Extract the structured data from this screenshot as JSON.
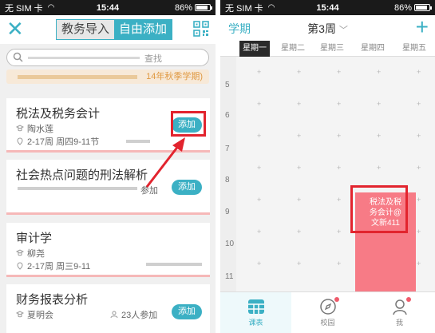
{
  "status_left": {
    "carrier": "无 SIM 卡",
    "wifi_icon": "wifi-icon",
    "time": "15:44",
    "battery": "86%",
    "battery_level": 0.86
  },
  "status_right": {
    "carrier": "无 SIM 卡",
    "wifi_icon": "wifi-icon",
    "time": "15:44",
    "battery": "86%",
    "battery_level": 0.86
  },
  "left_screen": {
    "close_icon": "close-icon",
    "tabs": [
      "教务导入",
      "自由添加"
    ],
    "active_tab": "自由添加",
    "qr_icon": "qr-code-icon",
    "search_placeholder": "查找",
    "semester_label": "14年秋季学期)",
    "accent_color": "#3bb0c4",
    "courses": [
      {
        "title": "税法及税务会计",
        "teacher": "陶水莲",
        "time": "2-17周 周四9-11节",
        "button": "添加"
      },
      {
        "title": "社会热点问题的刑法解析",
        "participants": "参加",
        "button": "添加"
      },
      {
        "title": "审计学",
        "teacher": "柳尧",
        "time": "2-17周 周三9-11"
      },
      {
        "title": "财务报表分析",
        "teacher": "夏明会",
        "participants": "23人参加",
        "button": "添加"
      }
    ]
  },
  "right_screen": {
    "term_label": "学期",
    "week_label": "第3周",
    "add_icon": "plus-icon",
    "days": [
      "星期一",
      "星期二",
      "星期三",
      "星期四",
      "星期五"
    ],
    "active_day": "星期一",
    "hours": [
      "5",
      "6",
      "7",
      "8",
      "9",
      "10",
      "11"
    ],
    "course_block": {
      "line1": "税法及税",
      "line2": "务会计@",
      "line3": "文新411",
      "color": "#f77b86"
    },
    "tabs": [
      {
        "label": "课表",
        "icon": "schedule-icon",
        "active": true
      },
      {
        "label": "校园",
        "icon": "compass-icon",
        "badge": true
      },
      {
        "label": "我",
        "icon": "person-icon",
        "badge": true
      }
    ]
  }
}
